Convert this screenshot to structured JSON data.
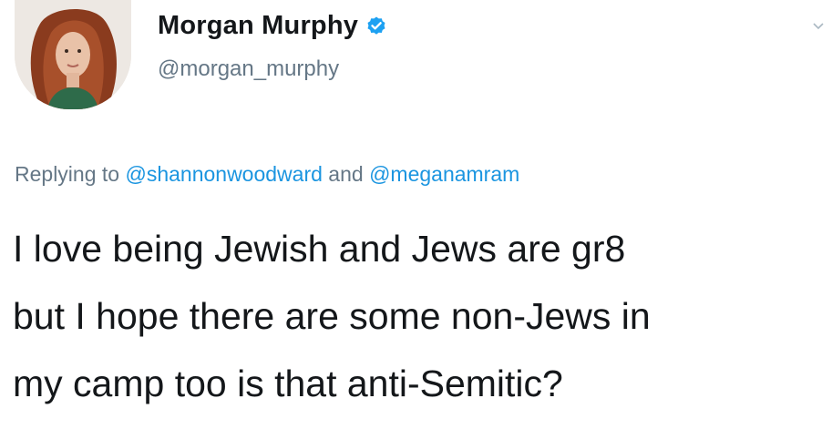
{
  "author": {
    "display_name": "Morgan Murphy",
    "handle": "@morgan_murphy",
    "verified": true
  },
  "reply": {
    "prefix": "Replying to",
    "mention_1": "@shannonwoodward",
    "conjunction": "and",
    "mention_2": "@meganamram"
  },
  "tweet": {
    "lines": [
      "I love being Jewish and Jews are gr8",
      "but I hope there are some non-Jews in",
      "my camp too is that anti-Semitic?"
    ]
  },
  "colors": {
    "text": "#14171a",
    "secondary": "#657786",
    "link": "#1b95e0",
    "verified": "#1da1f2"
  },
  "icons": {
    "verified": "verified-badge-icon",
    "menu": "chevron-down-icon"
  }
}
